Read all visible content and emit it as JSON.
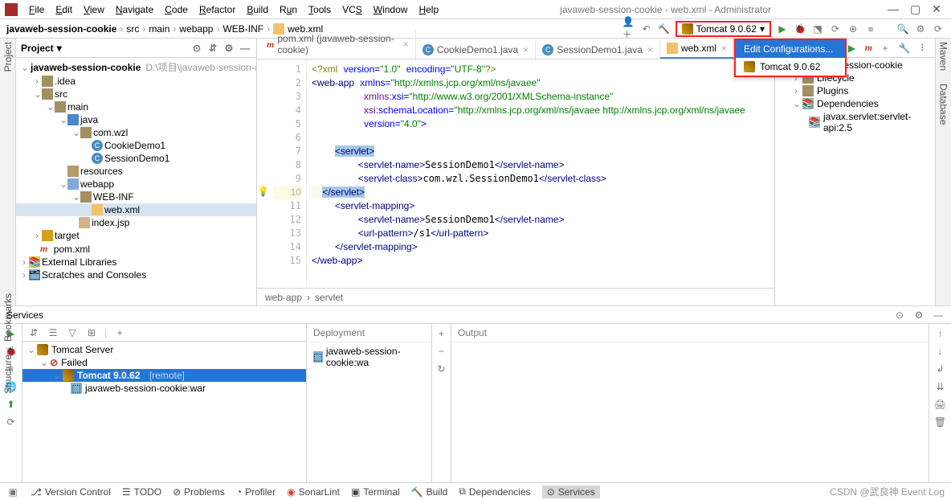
{
  "window_title": "javaweb-session-cookie - web.xml - Administrator",
  "menus": [
    "File",
    "Edit",
    "View",
    "Navigate",
    "Code",
    "Refactor",
    "Build",
    "Run",
    "Tools",
    "VCS",
    "Window",
    "Help"
  ],
  "menus_u": [
    "F",
    "E",
    "V",
    "N",
    "C",
    "R",
    "B",
    "R",
    "T",
    "S",
    "W",
    "H"
  ],
  "breadcrumb": [
    "javaweb-session-cookie",
    "src",
    "main",
    "webapp",
    "WEB-INF",
    "web.xml"
  ],
  "run_config": "Tomcat 9.0.62",
  "dropdown": {
    "selected": "Edit Configurations...",
    "items": [
      "Tomcat 9.0.62"
    ]
  },
  "project_panel_title": "Project",
  "tree": {
    "root": "javaweb-session-cookie",
    "root_hint": "D:\\项目\\javaweb-session-cookie",
    "idea": ".idea",
    "src": "src",
    "main": "main",
    "java": "java",
    "pkg": "com.wzl",
    "cls1": "CookieDemo1",
    "cls2": "SessionDemo1",
    "resources": "resources",
    "webapp": "webapp",
    "webinf": "WEB-INF",
    "webxml": "web.xml",
    "indexjsp": "index.jsp",
    "target": "target",
    "pom": "pom.xml",
    "ext": "External Libraries",
    "scratch": "Scratches and Consoles"
  },
  "tabs": [
    {
      "label": "pom.xml (javaweb-session-cookie)",
      "type": "mvn"
    },
    {
      "label": "CookieDemo1.java",
      "type": "cls"
    },
    {
      "label": "SessionDemo1.java",
      "type": "cls"
    },
    {
      "label": "web.xml",
      "type": "xml",
      "active": true
    }
  ],
  "code_crumb": [
    "web-app",
    "servlet"
  ],
  "maven": {
    "root": "javaweb-session-cookie",
    "lifecycle": "Lifecycle",
    "plugins": "Plugins",
    "deps": "Dependencies",
    "dep1": "javax.servlet:servlet-api:2.5"
  },
  "services_title": "Services",
  "services_tree": {
    "tomcat_server": "Tomcat Server",
    "failed": "Failed",
    "tomcat_v": "Tomcat 9.0.62",
    "tomcat_hint": "[remote]",
    "artifact": "javaweb-session-cookie:war"
  },
  "deployment": "Deployment",
  "deployment_item": "javaweb-session-cookie:wa",
  "output": "Output",
  "status": {
    "vc": "Version Control",
    "todo": "TODO",
    "problems": "Problems",
    "profiler": "Profiler",
    "sonar": "SonarLint",
    "terminal": "Terminal",
    "build": "Build",
    "deps": "Dependencies",
    "services": "Services",
    "watermark": "CSDN @武良神  Event Log"
  },
  "gutter_left": {
    "project": "Project",
    "bookmarks": "Bookmarks",
    "structure": "Structure"
  },
  "gutter_right": {
    "maven": "Maven",
    "database": "Database"
  }
}
